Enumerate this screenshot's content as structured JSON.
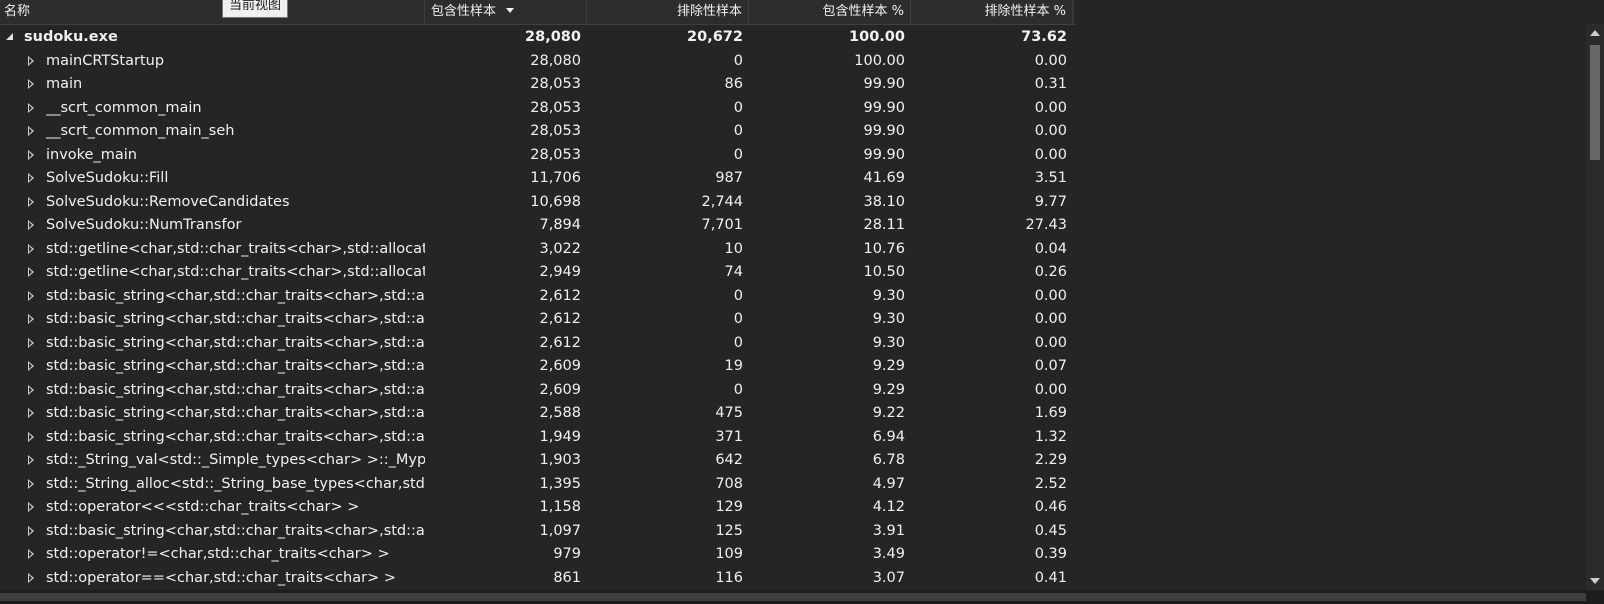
{
  "tooltip": "当前视图",
  "columns": {
    "name": "名称",
    "inclusive": "包含性样本",
    "exclusive": "排除性样本",
    "inclusive_pct": "包含性样本 %",
    "exclusive_pct": "排除性样本 %"
  },
  "rows": [
    {
      "name": "sudoku.exe",
      "inclusive": "28,080",
      "exclusive": "20,672",
      "inclusive_pct": "100.00",
      "exclusive_pct": "73.62",
      "root": true
    },
    {
      "name": "mainCRTStartup",
      "inclusive": "28,080",
      "exclusive": "0",
      "inclusive_pct": "100.00",
      "exclusive_pct": "0.00"
    },
    {
      "name": "main",
      "inclusive": "28,053",
      "exclusive": "86",
      "inclusive_pct": "99.90",
      "exclusive_pct": "0.31"
    },
    {
      "name": "__scrt_common_main",
      "inclusive": "28,053",
      "exclusive": "0",
      "inclusive_pct": "99.90",
      "exclusive_pct": "0.00"
    },
    {
      "name": "__scrt_common_main_seh",
      "inclusive": "28,053",
      "exclusive": "0",
      "inclusive_pct": "99.90",
      "exclusive_pct": "0.00"
    },
    {
      "name": "invoke_main",
      "inclusive": "28,053",
      "exclusive": "0",
      "inclusive_pct": "99.90",
      "exclusive_pct": "0.00"
    },
    {
      "name": "SolveSudoku::Fill",
      "inclusive": "11,706",
      "exclusive": "987",
      "inclusive_pct": "41.69",
      "exclusive_pct": "3.51"
    },
    {
      "name": "SolveSudoku::RemoveCandidates",
      "inclusive": "10,698",
      "exclusive": "2,744",
      "inclusive_pct": "38.10",
      "exclusive_pct": "9.77"
    },
    {
      "name": "SolveSudoku::NumTransfor",
      "inclusive": "7,894",
      "exclusive": "7,701",
      "inclusive_pct": "28.11",
      "exclusive_pct": "27.43"
    },
    {
      "name": "std::getline<char,std::char_traits<char>,std::allocator<char> >",
      "inclusive": "3,022",
      "exclusive": "10",
      "inclusive_pct": "10.76",
      "exclusive_pct": "0.04"
    },
    {
      "name": "std::getline<char,std::char_traits<char>,std::allocator<char> >",
      "inclusive": "2,949",
      "exclusive": "74",
      "inclusive_pct": "10.50",
      "exclusive_pct": "0.26"
    },
    {
      "name": "std::basic_string<char,std::char_traits<char>,std::allocator<char> >",
      "inclusive": "2,612",
      "exclusive": "0",
      "inclusive_pct": "9.30",
      "exclusive_pct": "0.00"
    },
    {
      "name": "std::basic_string<char,std::char_traits<char>,std::allocator<char> >",
      "inclusive": "2,612",
      "exclusive": "0",
      "inclusive_pct": "9.30",
      "exclusive_pct": "0.00"
    },
    {
      "name": "std::basic_string<char,std::char_traits<char>,std::allocator<char> >",
      "inclusive": "2,612",
      "exclusive": "0",
      "inclusive_pct": "9.30",
      "exclusive_pct": "0.00"
    },
    {
      "name": "std::basic_string<char,std::char_traits<char>,std::allocator<char> >",
      "inclusive": "2,609",
      "exclusive": "19",
      "inclusive_pct": "9.29",
      "exclusive_pct": "0.07"
    },
    {
      "name": "std::basic_string<char,std::char_traits<char>,std::allocator<char> >",
      "inclusive": "2,609",
      "exclusive": "0",
      "inclusive_pct": "9.29",
      "exclusive_pct": "0.00"
    },
    {
      "name": "std::basic_string<char,std::char_traits<char>,std::allocator<char> >",
      "inclusive": "2,588",
      "exclusive": "475",
      "inclusive_pct": "9.22",
      "exclusive_pct": "1.69"
    },
    {
      "name": "std::basic_string<char,std::char_traits<char>,std::allocator<char> >",
      "inclusive": "1,949",
      "exclusive": "371",
      "inclusive_pct": "6.94",
      "exclusive_pct": "1.32"
    },
    {
      "name": "std::_String_val<std::_Simple_types<char> >::_Myptr",
      "inclusive": "1,903",
      "exclusive": "642",
      "inclusive_pct": "6.78",
      "exclusive_pct": "2.29"
    },
    {
      "name": "std::_String_alloc<std::_String_base_types<char,std::allocator<char> > >",
      "inclusive": "1,395",
      "exclusive": "708",
      "inclusive_pct": "4.97",
      "exclusive_pct": "2.52"
    },
    {
      "name": "std::operator<<<std::char_traits<char> >",
      "inclusive": "1,158",
      "exclusive": "129",
      "inclusive_pct": "4.12",
      "exclusive_pct": "0.46"
    },
    {
      "name": "std::basic_string<char,std::char_traits<char>,std::allocator<char> >",
      "inclusive": "1,097",
      "exclusive": "125",
      "inclusive_pct": "3.91",
      "exclusive_pct": "0.45"
    },
    {
      "name": "std::operator!=<char,std::char_traits<char> >",
      "inclusive": "979",
      "exclusive": "109",
      "inclusive_pct": "3.49",
      "exclusive_pct": "0.39"
    },
    {
      "name": "std::operator==<char,std::char_traits<char> >",
      "inclusive": "861",
      "exclusive": "116",
      "inclusive_pct": "3.07",
      "exclusive_pct": "0.41"
    }
  ]
}
